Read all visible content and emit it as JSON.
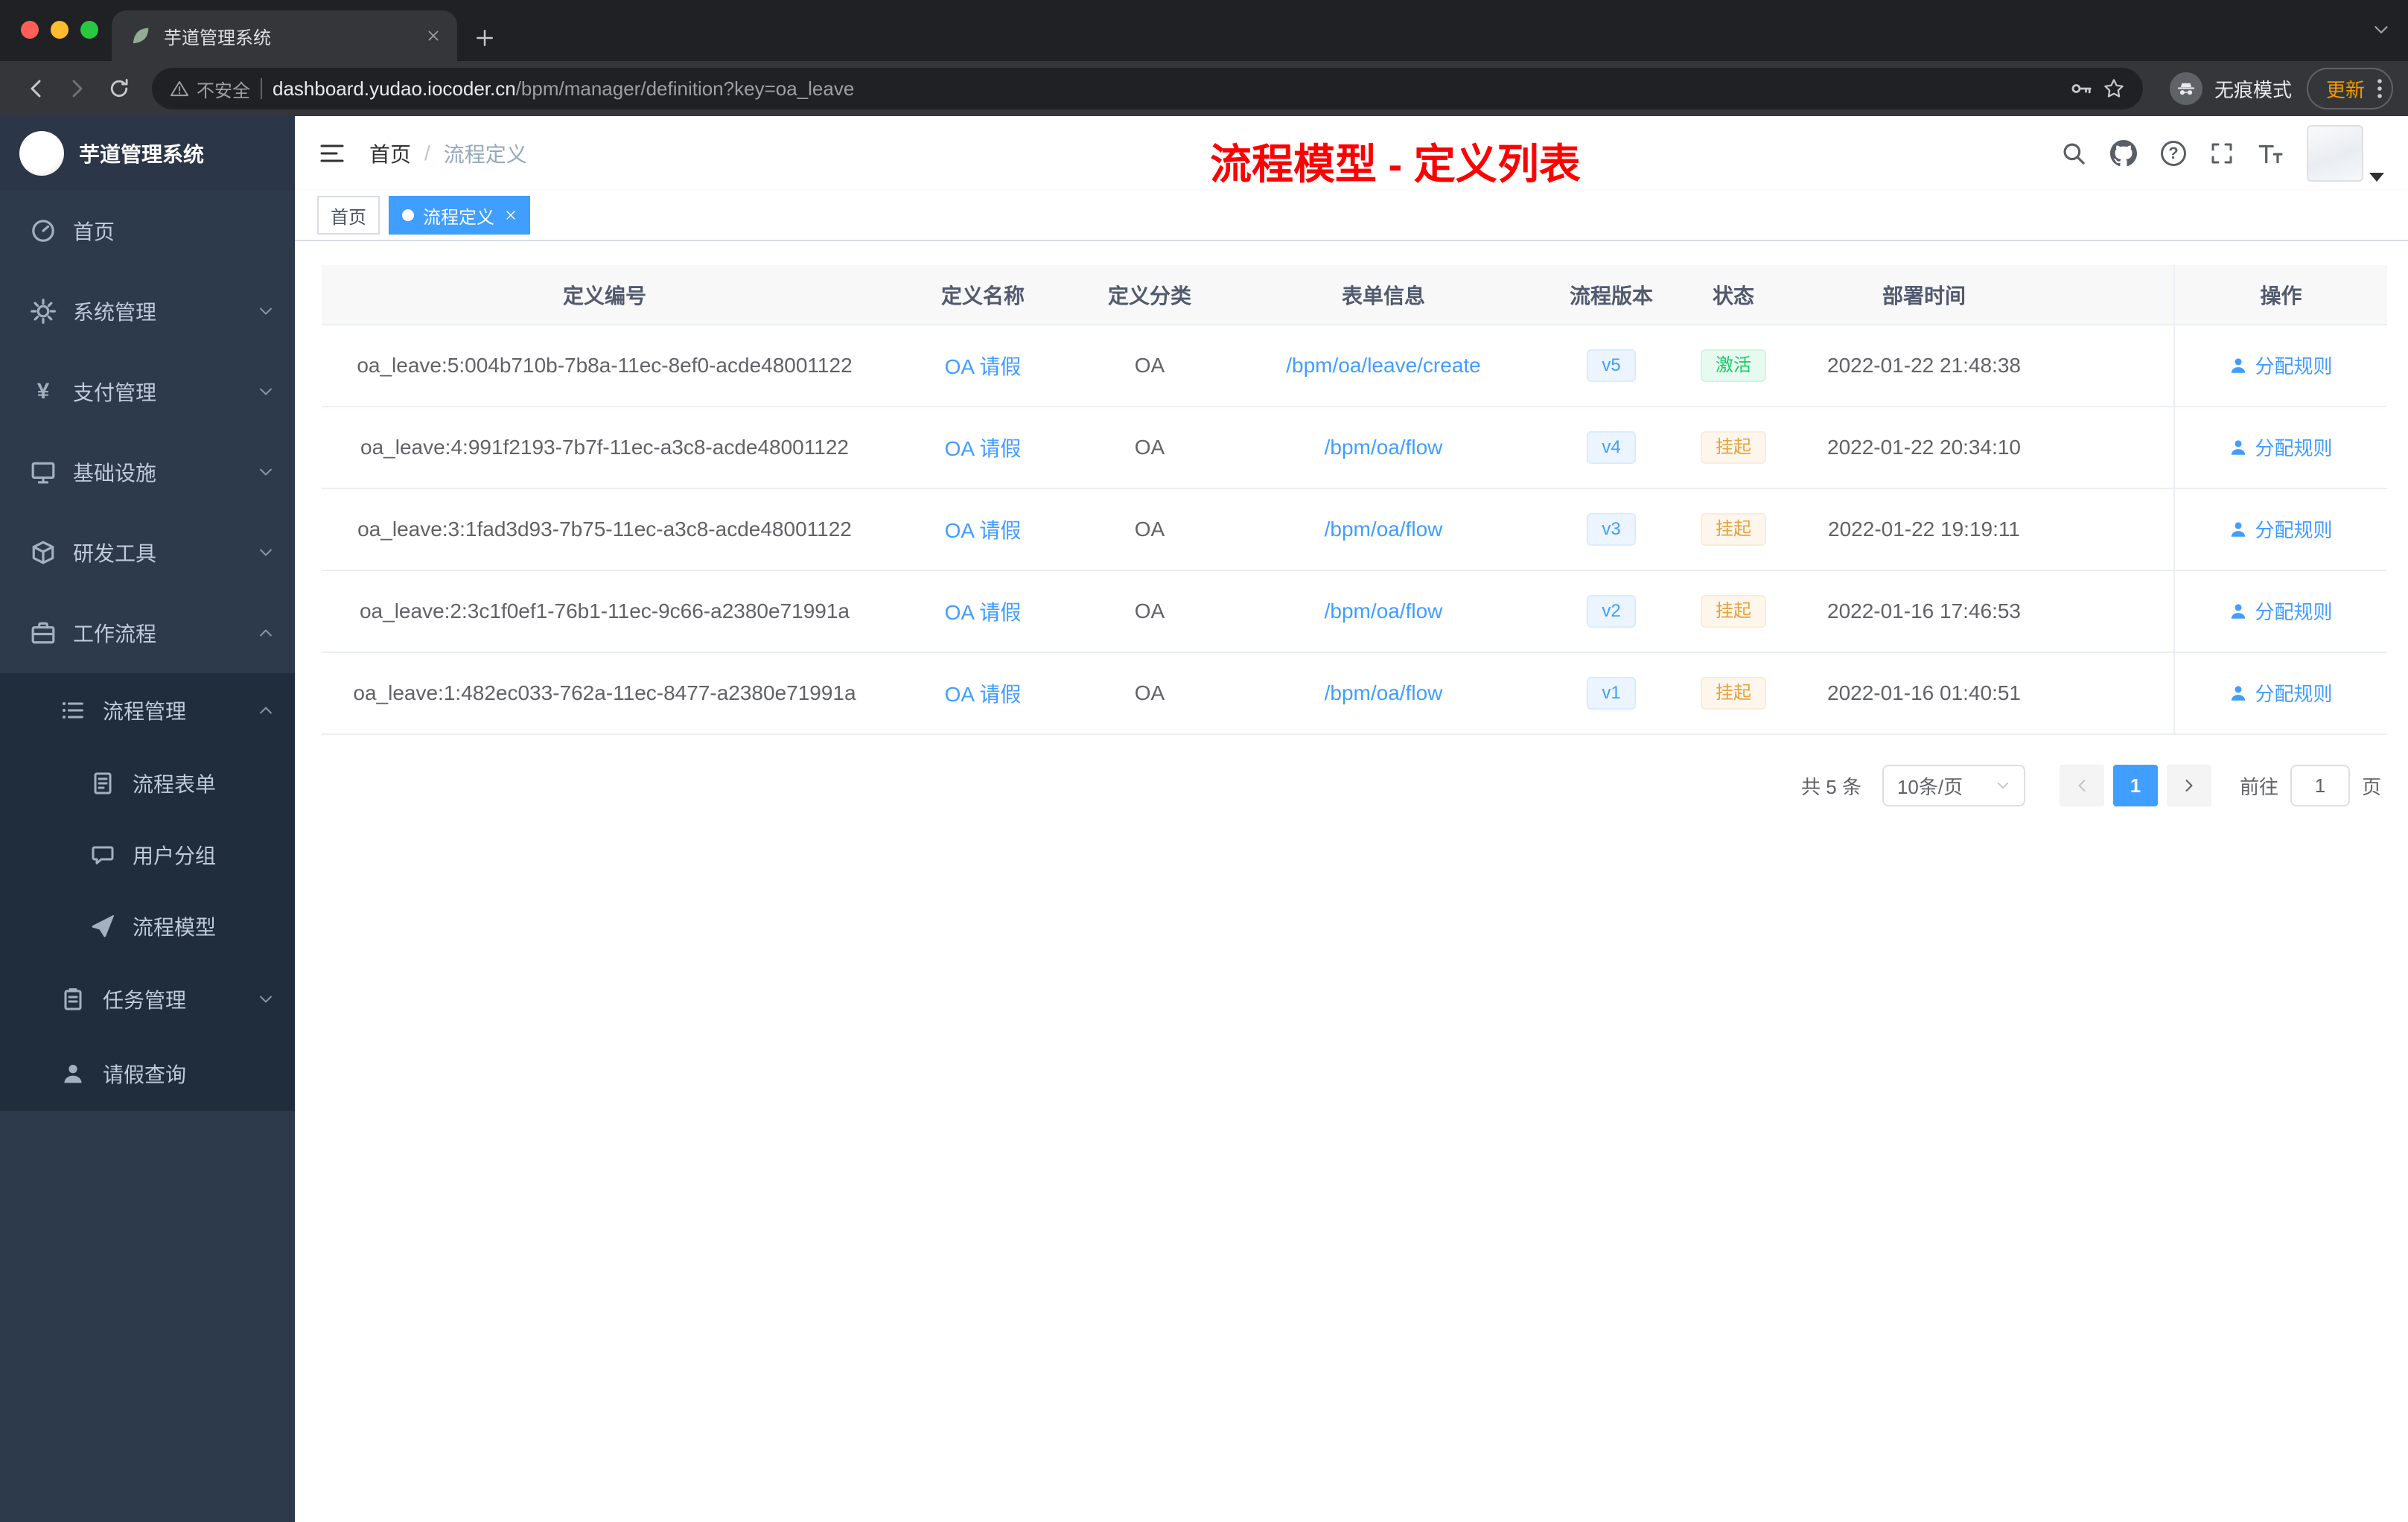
{
  "browser": {
    "tab": {
      "title": "芋道管理系统"
    },
    "security_label": "不安全",
    "url_host": "dashboard.yudao.iocoder.cn",
    "url_path": "/bpm/manager/definition?key=oa_leave",
    "incognito_label": "无痕模式",
    "update_label": "更新"
  },
  "sidebar": {
    "logo_title": "芋道管理系统",
    "home": "首页",
    "system": "系统管理",
    "payment": "支付管理",
    "infrastructure": "基础设施",
    "devtools": "研发工具",
    "workflow": "工作流程",
    "process_mgmt": "流程管理",
    "process_form": "流程表单",
    "user_group": "用户分组",
    "process_model": "流程模型",
    "task_mgmt": "任务管理",
    "leave_query": "请假查询"
  },
  "header": {
    "breadcrumb_home": "首页",
    "breadcrumb_separator": "/",
    "breadcrumb_current": "流程定义",
    "annotation": "流程模型 - 定义列表",
    "annotation_color": "#ff0000"
  },
  "glyphs": {
    "question": "?"
  },
  "tags": {
    "home": "首页",
    "active": "流程定义"
  },
  "table": {
    "columns": [
      "定义编号",
      "定义名称",
      "定义分类",
      "表单信息",
      "流程版本",
      "状态",
      "部署时间",
      "操作"
    ],
    "action_label": "分配规则",
    "rows": [
      {
        "id": "oa_leave:5:004b710b-7b8a-11ec-8ef0-acde48001122",
        "name": "OA 请假",
        "category": "OA",
        "form": "/bpm/oa/leave/create",
        "version": "v5",
        "status": "激活",
        "status_type": "success",
        "deploy_time": "2022-01-22 21:48:38"
      },
      {
        "id": "oa_leave:4:991f2193-7b7f-11ec-a3c8-acde48001122",
        "name": "OA 请假",
        "category": "OA",
        "form": "/bpm/oa/flow",
        "version": "v4",
        "status": "挂起",
        "status_type": "warning",
        "deploy_time": "2022-01-22 20:34:10"
      },
      {
        "id": "oa_leave:3:1fad3d93-7b75-11ec-a3c8-acde48001122",
        "name": "OA 请假",
        "category": "OA",
        "form": "/bpm/oa/flow",
        "version": "v3",
        "status": "挂起",
        "status_type": "warning",
        "deploy_time": "2022-01-22 19:19:11"
      },
      {
        "id": "oa_leave:2:3c1f0ef1-76b1-11ec-9c66-a2380e71991a",
        "name": "OA 请假",
        "category": "OA",
        "form": "/bpm/oa/flow",
        "version": "v2",
        "status": "挂起",
        "status_type": "warning",
        "deploy_time": "2022-01-16 17:46:53"
      },
      {
        "id": "oa_leave:1:482ec033-762a-11ec-8477-a2380e71991a",
        "name": "OA 请假",
        "category": "OA",
        "form": "/bpm/oa/flow",
        "version": "v1",
        "status": "挂起",
        "status_type": "warning",
        "deploy_time": "2022-01-16 01:40:51"
      }
    ]
  },
  "pagination": {
    "total": "共 5 条",
    "page_size": "10条/页",
    "current_page": "1",
    "goto_label": "前往",
    "goto_value": "1",
    "unit": "页"
  },
  "colors": {
    "accent_blue": "#409eff",
    "sidebar_bg": "#2d3a4b",
    "submenu_bg": "#1f2d3d",
    "status_active": "#13ce66",
    "status_suspended": "#e6a23c",
    "chrome_bg": "#202124"
  }
}
